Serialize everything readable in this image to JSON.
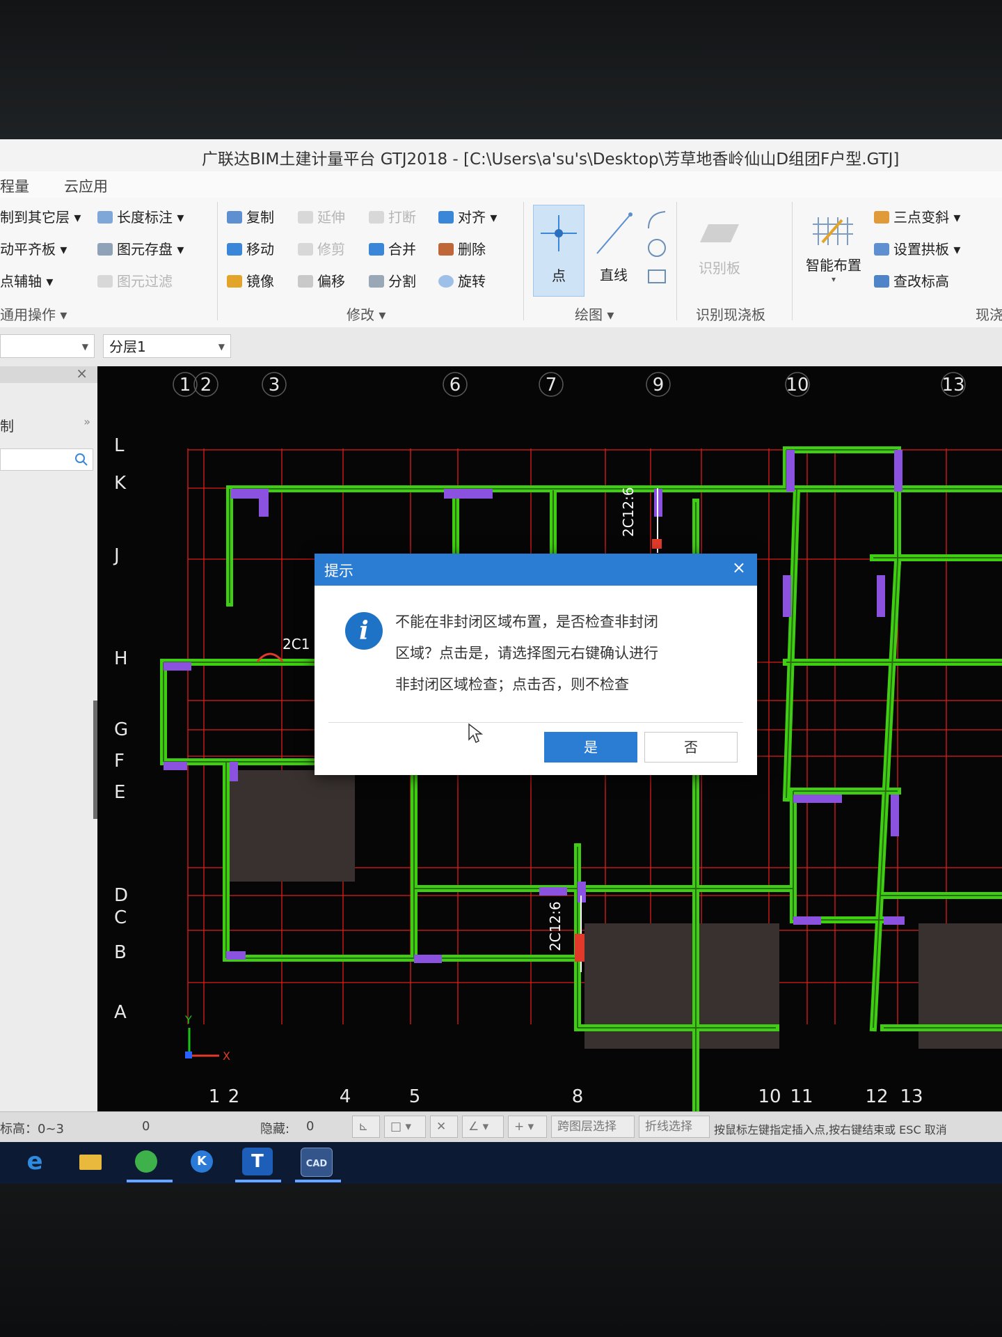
{
  "window": {
    "title": "广联达BIM土建计量平台 GTJ2018 - [C:\\Users\\a'su's\\Desktop\\芳草地香岭仙山D组团F户型.GTJ]"
  },
  "menu": [
    "程量",
    "云应用"
  ],
  "ribbon": {
    "general": {
      "items": [
        "制到其它层",
        "动平齐板",
        "点辅轴",
        "长度标注",
        "图元存盘",
        "图元过滤"
      ],
      "group_label": "通用操作"
    },
    "modify": {
      "items": [
        "复制",
        "延伸",
        "打断",
        "对齐",
        "移动",
        "修剪",
        "合并",
        "删除",
        "镜像",
        "偏移",
        "分割",
        "旋转"
      ],
      "group_label": "修改"
    },
    "draw": {
      "point": "点",
      "line": "直线",
      "group_label": "绘图"
    },
    "recognize": {
      "item": "识别板",
      "group_label": "识别现浇板"
    },
    "smart": {
      "smart_layout": "智能布置",
      "items": [
        "三点变斜",
        "设置拱板",
        "查改标高"
      ],
      "group_label": "现浇"
    }
  },
  "layer_bar": {
    "layer_select": "分层1"
  },
  "left_panel": {
    "label": "制",
    "close": "×"
  },
  "canvas": {
    "axis_top": [
      "1",
      "2",
      "3",
      "6",
      "7",
      "9",
      "10",
      "13"
    ],
    "axis_bottom": [
      "1",
      "2",
      "4",
      "5",
      "8",
      "10",
      "11",
      "12",
      "13"
    ],
    "axis_left": [
      "L",
      "K",
      "J",
      "H",
      "G",
      "F",
      "E",
      "D",
      "C",
      "B",
      "A"
    ],
    "annotations": [
      "2C12:6",
      "2C12:6",
      "2C1"
    ],
    "ucs_y": "Y",
    "ucs_x": "X"
  },
  "status_bar": {
    "elevation": "标高：0~3",
    "value": "0",
    "hidden_label": "隐藏:",
    "hidden_value": "0",
    "cross_layer": "跨图层选择",
    "polyline": "折线选择",
    "hint": "按鼠标左键指定插入点,按右键结束或 ESC 取消"
  },
  "taskbar": {
    "icons": [
      "ie-icon",
      "folder-icon",
      "browser-icon",
      "k-app-icon",
      "gtj-app-icon",
      "cad-app-icon"
    ],
    "k_label": "K",
    "t_label": "T",
    "cad_label": "CAD"
  },
  "dialog": {
    "title": "提示",
    "close": "×",
    "message_lines": [
      "不能在非封闭区域布置，是否检查非封闭",
      "区域？点击是，请选择图元右键确认进行",
      "非封闭区域检查；点击否，则不检查"
    ],
    "yes": "是",
    "no": "否"
  },
  "colors": {
    "accent": "#2b7cd3",
    "wall": "#3fcf12",
    "grid": "#e01c1c",
    "column": "#8b52e0",
    "canvas_bg": "#060606"
  }
}
